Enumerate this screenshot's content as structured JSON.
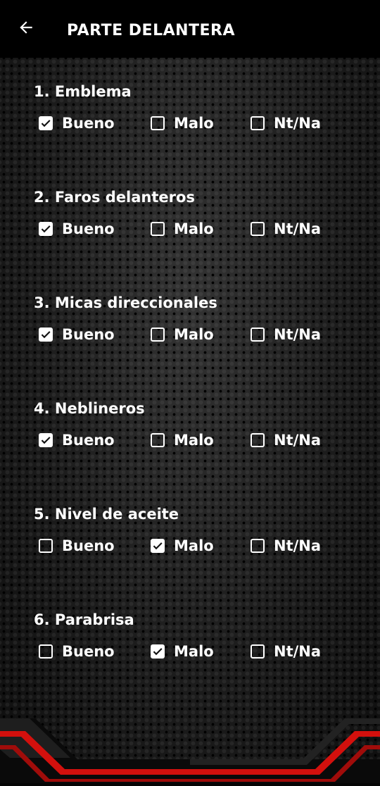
{
  "header": {
    "title": "PARTE DELANTERA",
    "back_icon": "arrow-left-icon"
  },
  "options": [
    "Bueno",
    "Malo",
    "Nt/Na"
  ],
  "items": [
    {
      "label": "1. Emblema",
      "selected": "Bueno"
    },
    {
      "label": "2. Faros delanteros",
      "selected": "Bueno"
    },
    {
      "label": "3. Micas direccionales",
      "selected": "Bueno"
    },
    {
      "label": "4. Neblineros",
      "selected": "Bueno"
    },
    {
      "label": "5. Nivel de aceite",
      "selected": "Malo"
    },
    {
      "label": "6. Parabrisa",
      "selected": "Malo"
    }
  ],
  "colors": {
    "accent": "#e0120f",
    "header_bg": "#000000",
    "text": "#ffffff"
  }
}
